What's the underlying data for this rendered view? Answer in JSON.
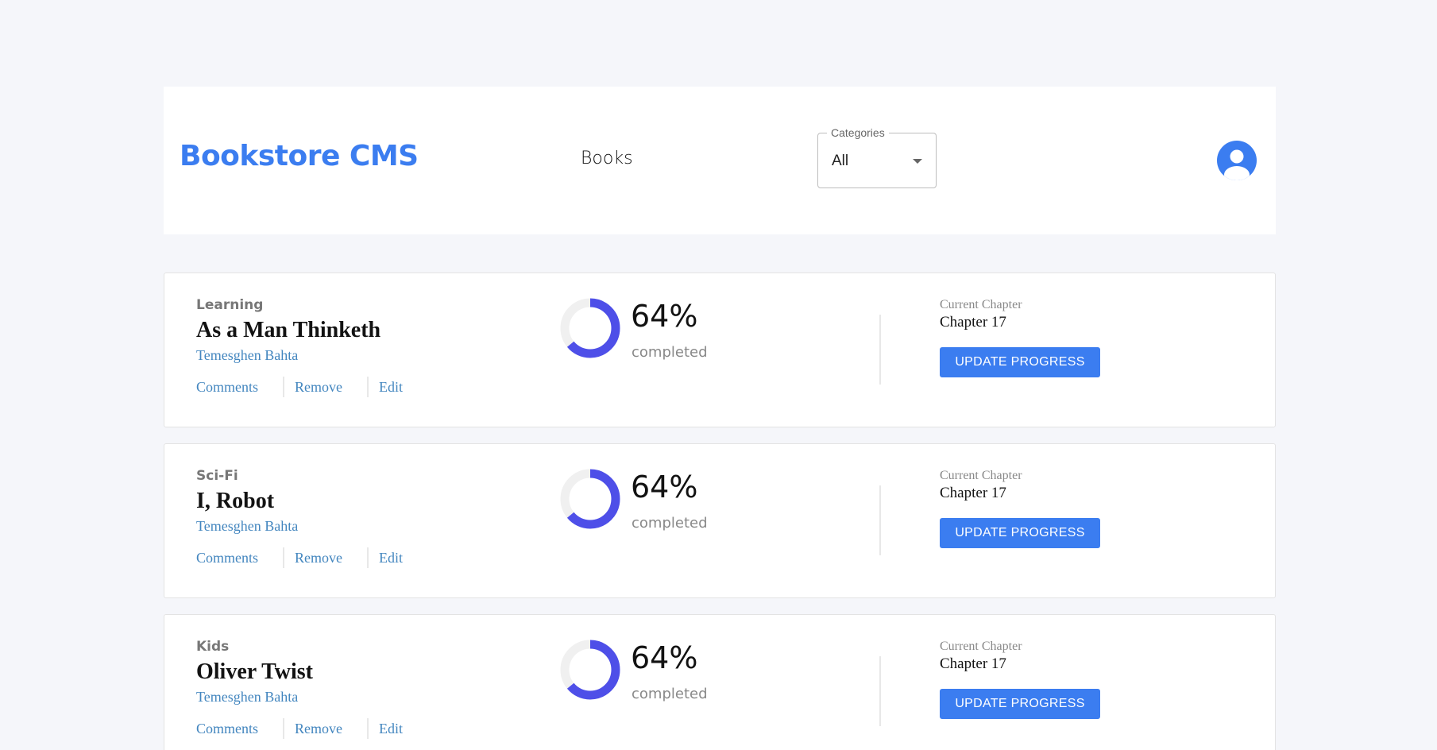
{
  "header": {
    "logo": "Bookstore CMS",
    "nav": {
      "books_label": "Books"
    },
    "categories": {
      "label": "Categories",
      "selected": "All"
    },
    "user_icon": "user-circle-icon"
  },
  "colors": {
    "accent": "#3b7df0",
    "progress": "#4e4fe8",
    "progress_track": "#f0f0f0",
    "author_link": "#4386bf"
  },
  "books": [
    {
      "genre": "Learning",
      "title": "As a Man Thinketh",
      "author": "Temesghen Bahta",
      "actions": {
        "comments": "Comments",
        "remove": "Remove",
        "edit": "Edit"
      },
      "progress": {
        "percent": 64,
        "percent_label": "64%",
        "status": "completed"
      },
      "chapter": {
        "label": "Current Chapter",
        "value": "Chapter 17"
      },
      "update_label": "UPDATE PROGRESS"
    },
    {
      "genre": "Sci-Fi",
      "title": "I, Robot",
      "author": "Temesghen Bahta",
      "actions": {
        "comments": "Comments",
        "remove": "Remove",
        "edit": "Edit"
      },
      "progress": {
        "percent": 64,
        "percent_label": "64%",
        "status": "completed"
      },
      "chapter": {
        "label": "Current Chapter",
        "value": "Chapter 17"
      },
      "update_label": "UPDATE PROGRESS"
    },
    {
      "genre": "Kids",
      "title": "Oliver Twist",
      "author": "Temesghen Bahta",
      "actions": {
        "comments": "Comments",
        "remove": "Remove",
        "edit": "Edit"
      },
      "progress": {
        "percent": 64,
        "percent_label": "64%",
        "status": "completed"
      },
      "chapter": {
        "label": "Current Chapter",
        "value": "Chapter 17"
      },
      "update_label": "UPDATE PROGRESS"
    }
  ]
}
